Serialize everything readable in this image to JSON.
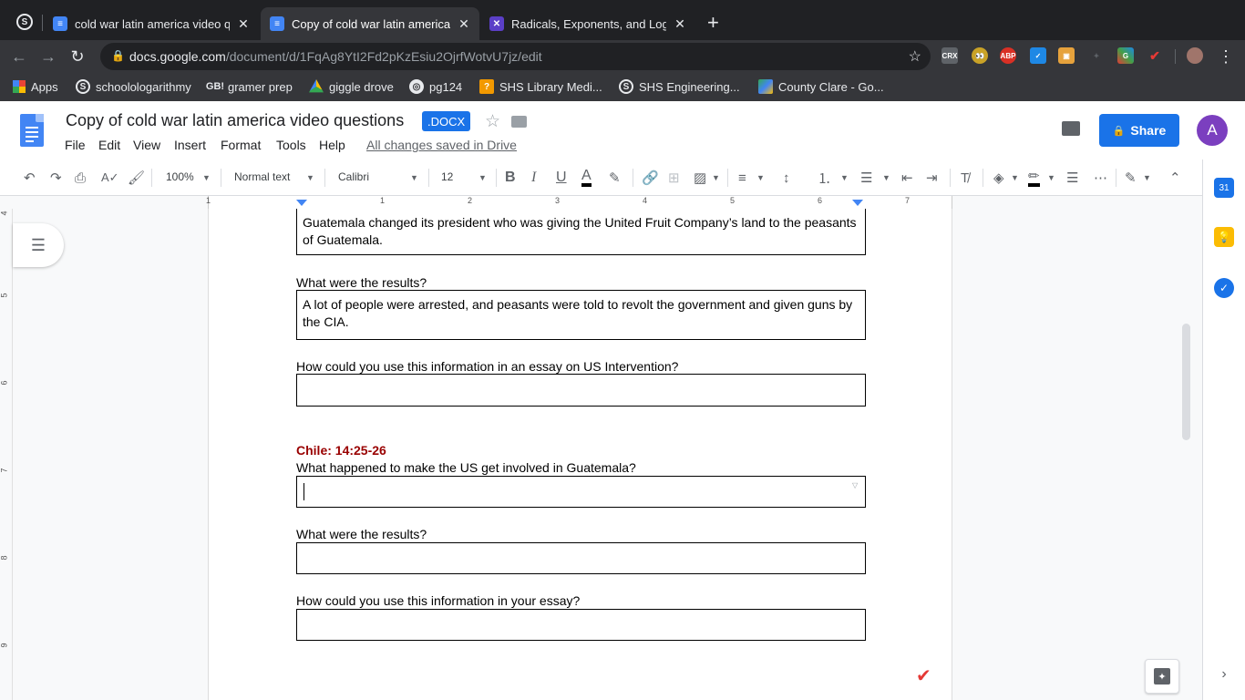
{
  "browser": {
    "tabs": [
      {
        "title": "cold war latin america video qu",
        "icon": "google-docs-icon",
        "active": false
      },
      {
        "title": "Copy of cold war latin america",
        "icon": "google-docs-icon",
        "active": true
      },
      {
        "title": "Radicals, Exponents, and Logs",
        "icon": "x-app-icon",
        "active": false
      }
    ],
    "new_tab_label": "+",
    "url_host": "docs.google.com",
    "url_path": "/document/d/1FqAg8YtI2Fd2pKzEsiu2OjrfWotvU7jz/edit",
    "extensions": [
      "CRX",
      "ABP"
    ],
    "bookmarks": [
      {
        "label": "Apps",
        "icon": "apps-grid-icon"
      },
      {
        "label": "schoolologarithmy",
        "icon": "schoology-icon"
      },
      {
        "label": "gramer prep",
        "icon": "gb-icon"
      },
      {
        "label": "giggle drove",
        "icon": "drive-icon"
      },
      {
        "label": "pg124",
        "icon": "globe-icon"
      },
      {
        "label": "SHS Library Medi...",
        "icon": "library-icon"
      },
      {
        "label": "SHS Engineering...",
        "icon": "schoology-icon"
      },
      {
        "label": "County Clare - Go...",
        "icon": "maps-icon"
      }
    ]
  },
  "docs": {
    "title": "Copy of cold war latin america video questions",
    "badge": ".DOCX",
    "menus": [
      "File",
      "Edit",
      "View",
      "Insert",
      "Format",
      "Tools",
      "Help"
    ],
    "saved_status": "All changes saved in Drive",
    "share_label": "Share",
    "avatar_letter": "A"
  },
  "toolbar": {
    "zoom": "100%",
    "style": "Normal text",
    "font": "Calibri",
    "size": "12",
    "bold": "B",
    "italic": "I",
    "underline": "U",
    "text_color": "A"
  },
  "ruler": {
    "marks": [
      "1",
      "1",
      "2",
      "3",
      "4",
      "5",
      "6",
      "7"
    ]
  },
  "vruler": {
    "marks": [
      "4",
      "5",
      "6",
      "7",
      "8",
      "9"
    ]
  },
  "document": {
    "answer_guatemala_change": "Guatemala changed its president who was giving the United Fruit Company’s land to the peasants of Guatemala.",
    "q_results_1": "What were the results?",
    "answer_results_1": "A lot of people were arrested, and peasants were told to revolt the government and given guns by the CIA.",
    "q_essay_1": "How could you use this information in an essay on US Intervention?",
    "answer_essay_1": "",
    "chile_heading": "Chile: 14:25-26",
    "q_happened_2": "What happened to make the US get involved in Guatemala?",
    "answer_happened_2": "",
    "q_results_2": "What were the results?",
    "answer_results_2": "",
    "q_essay_2": "How could you use this information in your essay?",
    "answer_essay_2": ""
  },
  "side_panel": {
    "calendar_label": "31"
  }
}
